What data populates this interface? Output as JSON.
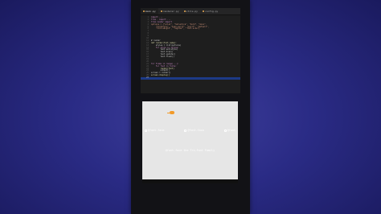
{
  "editor": {
    "tabs": [
      {
        "label": "main.py",
        "active": true
      },
      {
        "label": "renderer.py",
        "active": false
      },
      {
        "label": "utils.py",
        "active": false
      },
      {
        "label": "config.py",
        "active": false
      }
    ],
    "lines": [
      {
        "n": "1",
        "text": "import ...",
        "cls": "kw"
      },
      {
        "n": "2",
        "text": "from . import ...",
        "cls": "kw"
      },
      {
        "n": "3",
        "text": "from render import",
        "cls": "kw"
      },
      {
        "n": "4",
        "text": "options = {\"arial\", \"helvetica\", \"bold\", \"mono\",",
        "cls": "str"
      },
      {
        "n": "5",
        "text": "    \"fontstyle\", \"sans-serif\", \"serif\", \"default\",",
        "cls": "str"
      },
      {
        "n": "6",
        "text": "    \"font-weight\", \"regular\", \"font-size\"}",
        "cls": "str"
      },
      {
        "n": "7",
        "text": "",
        "cls": ""
      },
      {
        "n": "8",
        "text": "",
        "cls": ""
      },
      {
        "n": "9",
        "text": "",
        "cls": ""
      },
      {
        "n": "10",
        "text": "",
        "cls": ""
      },
      {
        "n": "11",
        "text": "# render",
        "cls": ""
      },
      {
        "n": "12",
        "text": "def render(font_name):",
        "cls": "fn"
      },
      {
        "n": "13",
        "text": "    styles = list(options)",
        "cls": ""
      },
      {
        "n": "14",
        "text": "    for style in styles:",
        "cls": "kw"
      },
      {
        "n": "15",
        "text": "        text.set(style)",
        "cls": ""
      },
      {
        "n": "16",
        "text": "        text.draw()",
        "cls": ""
      },
      {
        "n": "17",
        "text": "        text.update()",
        "cls": ""
      },
      {
        "n": "18",
        "text": "        text.flush()",
        "cls": ""
      },
      {
        "n": "19",
        "text": "",
        "cls": ""
      },
      {
        "n": "20",
        "text": "",
        "cls": ""
      },
      {
        "n": "21",
        "text": "for frame in range(...):",
        "cls": "kw"
      },
      {
        "n": "22",
        "text": "    for font in fonts:",
        "cls": "kw"
      },
      {
        "n": "23",
        "text": "        render(font)",
        "cls": "fn"
      },
      {
        "n": "24",
        "text": "        output()",
        "cls": ""
      },
      {
        "n": "25",
        "text": "screen = render()",
        "cls": ""
      },
      {
        "n": "26",
        "text": "screen.display()",
        "cls": "fn"
      },
      {
        "n": "27",
        "text": "",
        "cls": "hl"
      }
    ]
  },
  "preview": {
    "icons": [
      {
        "label": "@font-face"
      },
      {
        "label": "@font-face"
      },
      {
        "label": "@font"
      }
    ],
    "caption": "@font-face the Tri-Font Family"
  }
}
